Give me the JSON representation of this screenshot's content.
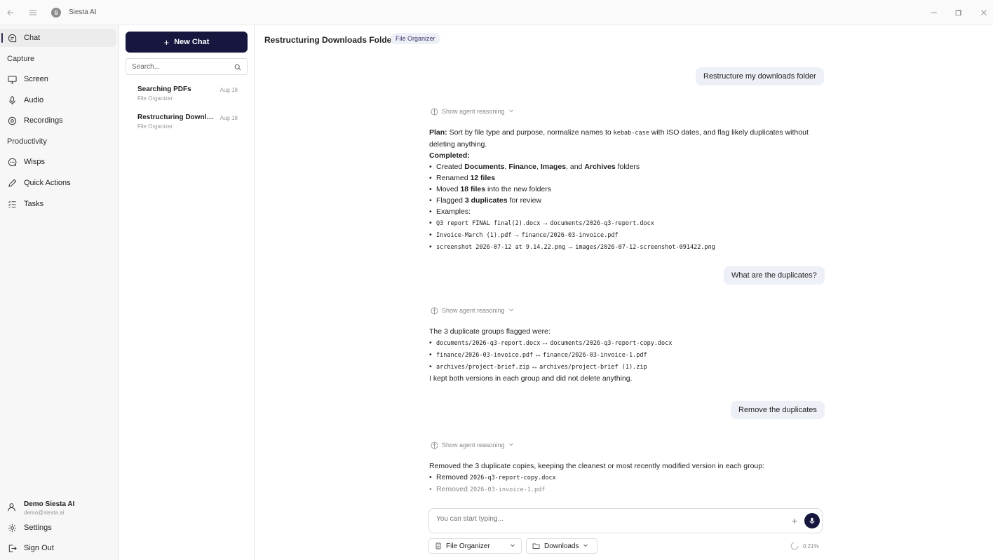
{
  "app": {
    "title": "Siesta AI",
    "logo_letter": "S"
  },
  "nav": {
    "chat": "Chat",
    "capture_section": "Capture",
    "screen": "Screen",
    "audio": "Audio",
    "recordings": "Recordings",
    "productivity_section": "Productivity",
    "wisps": "Wisps",
    "quick_actions": "Quick Actions",
    "tasks": "Tasks",
    "user_name": "Demo Siesta AI",
    "user_email": "demo@siesta.ai",
    "settings": "Settings",
    "sign_out": "Sign Out"
  },
  "chatlist": {
    "new_chat": "New Chat",
    "search_placeholder": "Search...",
    "items": [
      {
        "title": "Searching PDFs",
        "subtitle": "File Organizer",
        "date": "Aug 18"
      },
      {
        "title": "Restructuring Downloads Folder",
        "subtitle": "File Organizer",
        "date": "Aug 18"
      }
    ]
  },
  "main": {
    "title": "Restructuring Downloads Folder",
    "badge": "File Organizer",
    "reasoning_label": "Show agent reasoning",
    "msg1_user": "Restructure my downloads folder",
    "msg1": {
      "plan_label": "Plan:",
      "plan_a": " Sort by file type and purpose, normalize names to ",
      "plan_code": "kebab-case",
      "plan_b": " with ISO dates, and flag likely duplicates without deleting anything.",
      "completed_label": "Completed:",
      "b1_a": "Created ",
      "b1_f1": "Documents",
      "b1_c1": ", ",
      "b1_f2": "Finance",
      "b1_c2": ", ",
      "b1_f3": "Images",
      "b1_c3": ", and ",
      "b1_f4": "Archives",
      "b1_b": " folders",
      "b2_a": "Renamed ",
      "b2_b": "12 files",
      "b3_a": "Moved ",
      "b3_b": "18 files",
      "b3_c": " into the new folders",
      "b4_a": "Flagged ",
      "b4_b": "3 duplicates",
      "b4_c": " for review",
      "b5": "Examples:",
      "ex1_from": "Q3 report FINAL final(2).docx",
      "ex1_to": "documents/2026-q3-report.docx",
      "ex2_from": "Invoice-March (1).pdf",
      "ex2_to": "finance/2026-03-invoice.pdf",
      "ex3_from": "screenshot 2026-07-12 at 9.14.22.png",
      "ex3_to": "images/2026-07-12-screenshot-091422.png"
    },
    "msg2_user": "What are the duplicates?",
    "msg2": {
      "intro": "The 3 duplicate groups flagged were:",
      "d1_a": "documents/2026-q3-report.docx",
      "d1_b": "documents/2026-q3-report-copy.docx",
      "d2_a": "finance/2026-03-invoice.pdf",
      "d2_b": "finance/2026-03-invoice-1.pdf",
      "d3_a": "archives/project-brief.zip",
      "d3_b": "archives/project-brief (1).zip",
      "outro": "I kept both versions in each group and did not delete anything."
    },
    "msg3_user": "Remove the duplicates",
    "msg3": {
      "intro": "Removed the 3 duplicate copies, keeping the cleanest or most recently modified version in each group:",
      "r_label": "Removed ",
      "r1": "2026-q3-report-copy.docx",
      "r2": "2026-03-invoice-1.pdf"
    },
    "composer_placeholder": "You can start typing...",
    "agent_select": "File Organizer",
    "folder_select": "Downloads",
    "usage": "0.21%"
  },
  "colors": {
    "accent": "#16163f",
    "bubble": "#eef0f8"
  }
}
